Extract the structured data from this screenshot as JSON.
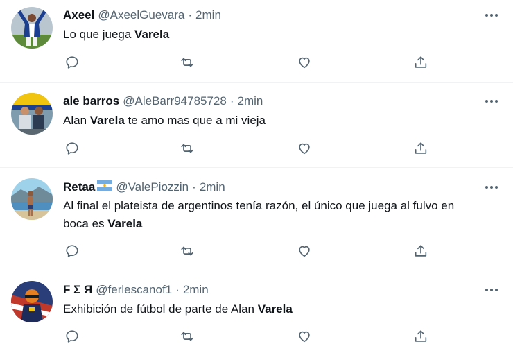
{
  "tweets": [
    {
      "name": "Axeel",
      "handle": "@AxeelGuevara",
      "separator": "·",
      "time": "2min",
      "text_parts": [
        "Lo que juega ",
        "Varela",
        ""
      ],
      "avatar_icon": "avatar-player-blue-white",
      "more_icon": "more-dots-icon"
    },
    {
      "name": "ale barros",
      "handle": "@AleBarr94785728",
      "separator": "·",
      "time": "2min",
      "text_parts": [
        "Alan ",
        "Varela",
        " te amo mas que a mi vieja"
      ],
      "avatar_icon": "avatar-friends-photo",
      "more_icon": "more-dots-icon"
    },
    {
      "name": "Retaa",
      "flag_icon": "argentina-flag-icon",
      "handle": "@ValePiozzin",
      "separator": "·",
      "time": "2min",
      "text_parts": [
        "Al final el plateista de argentinos tenía razón, el único que juega al fulvo en",
        "boca es ",
        "Varela"
      ],
      "avatar_icon": "avatar-beach-photo",
      "more_icon": "more-dots-icon"
    },
    {
      "name": "F Σ Я",
      "handle": "@ferlescanof1",
      "separator": "·",
      "time": "2min",
      "text_parts": [
        "Exhibición de fútbol de parte de Alan ",
        "Varela",
        ""
      ],
      "avatar_icon": "avatar-racing-driver",
      "more_icon": "more-dots-icon"
    }
  ],
  "action_icons": [
    "reply-icon",
    "retweet-icon",
    "like-icon",
    "share-icon"
  ],
  "colors": {
    "text": "#0f1419",
    "secondary": "#536471",
    "divider": "#eff3f4"
  }
}
